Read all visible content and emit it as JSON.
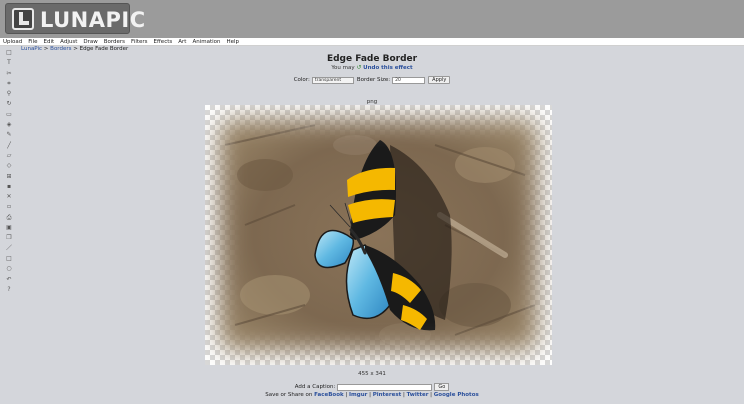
{
  "app": {
    "logo_text": "LUNAPIC"
  },
  "menu": [
    "Upload",
    "File",
    "Edit",
    "Adjust",
    "Draw",
    "Borders",
    "Filters",
    "Effects",
    "Art",
    "Animation",
    "Help"
  ],
  "toolbar": {
    "tools": [
      {
        "name": "select-tool-icon",
        "glyph": "□"
      },
      {
        "name": "text-tool-icon",
        "glyph": "T"
      },
      {
        "name": "cut-tool-icon",
        "glyph": "✂"
      },
      {
        "name": "crop-tool-icon",
        "glyph": "⌗"
      },
      {
        "name": "zoom-tool-icon",
        "glyph": "⚲"
      },
      {
        "name": "rotate-tool-icon",
        "glyph": "↻"
      },
      {
        "name": "border-tool-icon",
        "glyph": "▭"
      },
      {
        "name": "fill-tool-icon",
        "glyph": "◈"
      },
      {
        "name": "pencil-tool-icon",
        "glyph": "✎"
      },
      {
        "name": "brush-tool-icon",
        "glyph": "╱"
      },
      {
        "name": "folder-tool-icon",
        "glyph": "▱"
      },
      {
        "name": "eraser-tool-icon",
        "glyph": "◇"
      },
      {
        "name": "stamp-tool-icon",
        "glyph": "⊞"
      },
      {
        "name": "save-tool-icon",
        "glyph": "▪"
      },
      {
        "name": "close-tool-icon",
        "glyph": "✕"
      },
      {
        "name": "new-tool-icon",
        "glyph": "▫"
      },
      {
        "name": "print-tool-icon",
        "glyph": "⎙"
      },
      {
        "name": "layers-tool-icon",
        "glyph": "▣"
      },
      {
        "name": "copy-tool-icon",
        "glyph": "❐"
      },
      {
        "name": "line-tool-icon",
        "glyph": "／"
      },
      {
        "name": "rectangle-tool-icon",
        "glyph": "□"
      },
      {
        "name": "circle-tool-icon",
        "glyph": "○"
      },
      {
        "name": "undo-tool-icon",
        "glyph": "↶"
      },
      {
        "name": "help-tool-icon",
        "glyph": "?"
      }
    ]
  },
  "breadcrumb": {
    "home": "LunaPic",
    "sep1": " > ",
    "section": "Borders",
    "sep2": " > ",
    "current": "Edge Fade Border"
  },
  "page": {
    "title": "Edge Fade Border",
    "undo_prefix": "You may ",
    "undo_link": "Undo this effect"
  },
  "options": {
    "color_label": "Color:",
    "color_value": "transparent",
    "size_label": "Border Size:",
    "size_value": "20",
    "apply_label": "Apply"
  },
  "image": {
    "format": "png",
    "dimensions": "455 x 341"
  },
  "caption": {
    "label": "Add a Caption:",
    "go_label": "Go"
  },
  "share": {
    "prefix": "Save or Share on ",
    "links": [
      "FaceBook",
      "Imgur",
      "Pinterest",
      "Twitter",
      "Google Photos"
    ],
    "separator": " | "
  },
  "colors": {
    "header": "#9b9b9b",
    "content_bg": "#d4d6db",
    "link": "#2a4f9b"
  }
}
